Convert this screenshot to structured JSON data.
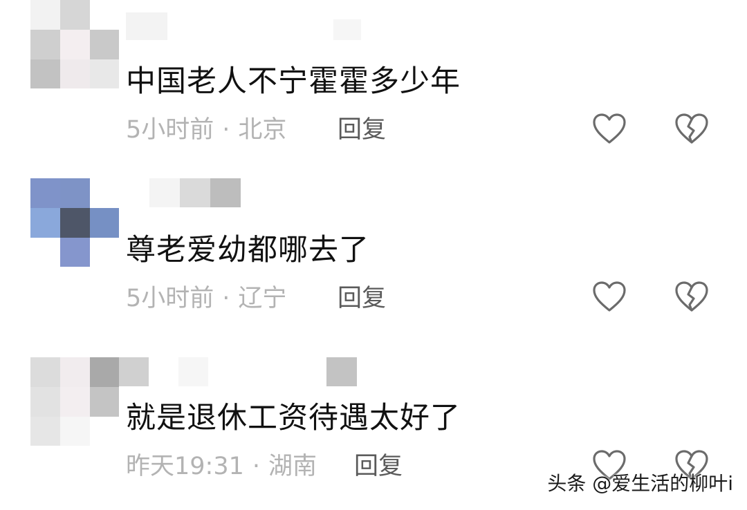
{
  "comments": [
    {
      "text": "中国老人不宁霍霍多少年",
      "time": "5小时前",
      "separator": "·",
      "location": "北京",
      "reply_label": "回复"
    },
    {
      "text": "尊老爱幼都哪去了",
      "time": "5小时前",
      "separator": "·",
      "location": "辽宁",
      "reply_label": "回复"
    },
    {
      "text": "就是退休工资待遇太好了",
      "time": "昨天19:31",
      "separator": "·",
      "location": "湖南",
      "reply_label": "回复"
    }
  ],
  "icons": {
    "like": "heart-outline-icon",
    "dislike": "broken-heart-icon",
    "icon_color": "#6b6b6b"
  },
  "watermark": "头条 @爱生活的柳叶i"
}
